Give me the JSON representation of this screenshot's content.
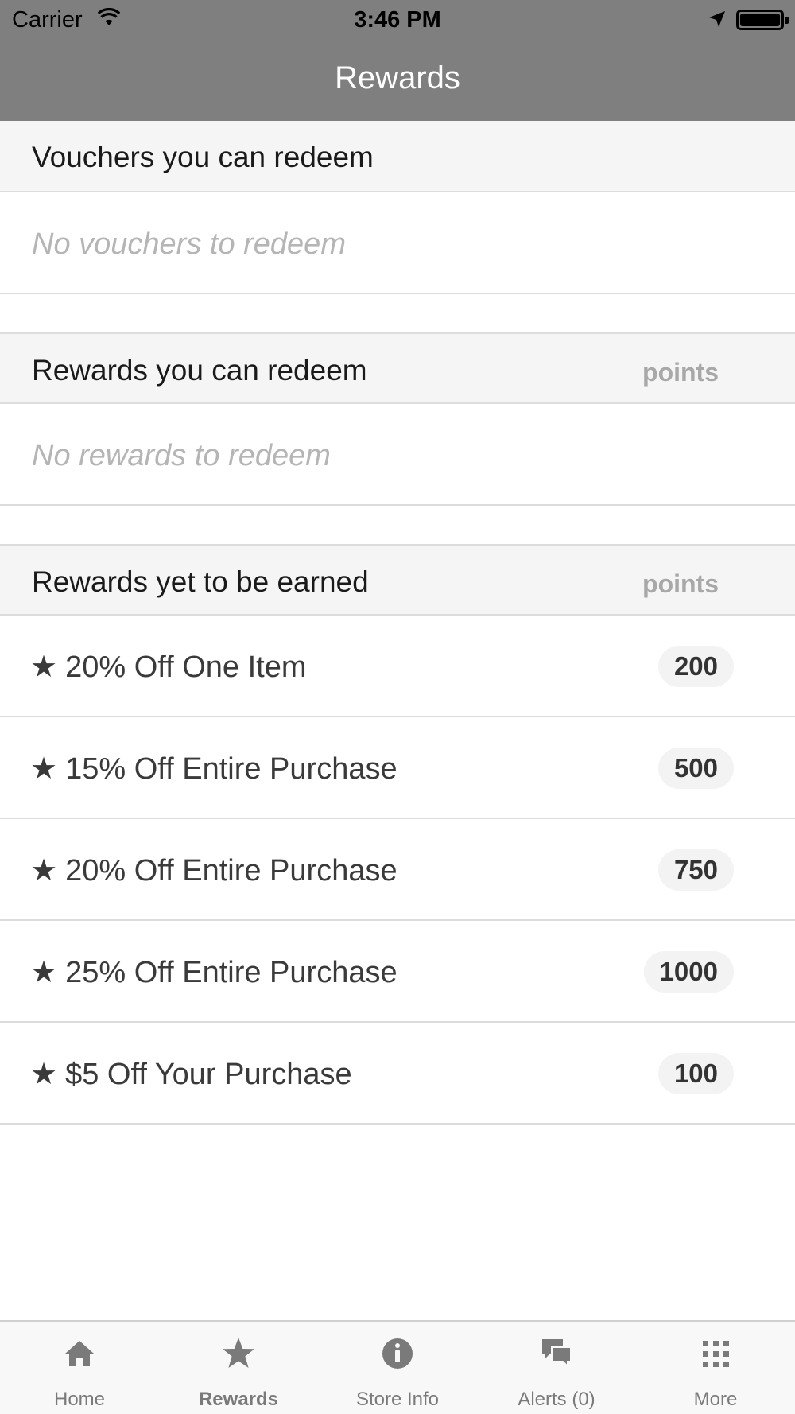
{
  "status_bar": {
    "carrier": "Carrier",
    "time": "3:46 PM"
  },
  "nav": {
    "title": "Rewards"
  },
  "sections": {
    "vouchers": {
      "title": "Vouchers you can redeem",
      "empty": "No vouchers to redeem"
    },
    "redeemable": {
      "title": "Rewards you can redeem",
      "points_label": "points",
      "empty": "No rewards to redeem"
    },
    "upcoming": {
      "title": "Rewards yet to be earned",
      "points_label": "points"
    }
  },
  "rewards": [
    {
      "label": "20% Off One Item",
      "points": "200"
    },
    {
      "label": "15% Off Entire Purchase",
      "points": "500"
    },
    {
      "label": "20% Off Entire Purchase",
      "points": "750"
    },
    {
      "label": "25% Off Entire Purchase",
      "points": "1000"
    },
    {
      "label": "$5 Off Your Purchase",
      "points": "100"
    }
  ],
  "reward_star": "★",
  "tabs": [
    {
      "label": "Home",
      "icon": "home-icon"
    },
    {
      "label": "Rewards",
      "icon": "star-icon",
      "active": true
    },
    {
      "label": "Store Info",
      "icon": "info-icon"
    },
    {
      "label": "Alerts (0)",
      "icon": "chat-bubbles-icon"
    },
    {
      "label": "More",
      "icon": "grid-dots-icon"
    }
  ],
  "colors": {
    "nav_background": "#7f7f7f",
    "section_background": "#f5f5f5",
    "tab_icon": "#7a7a7a"
  }
}
